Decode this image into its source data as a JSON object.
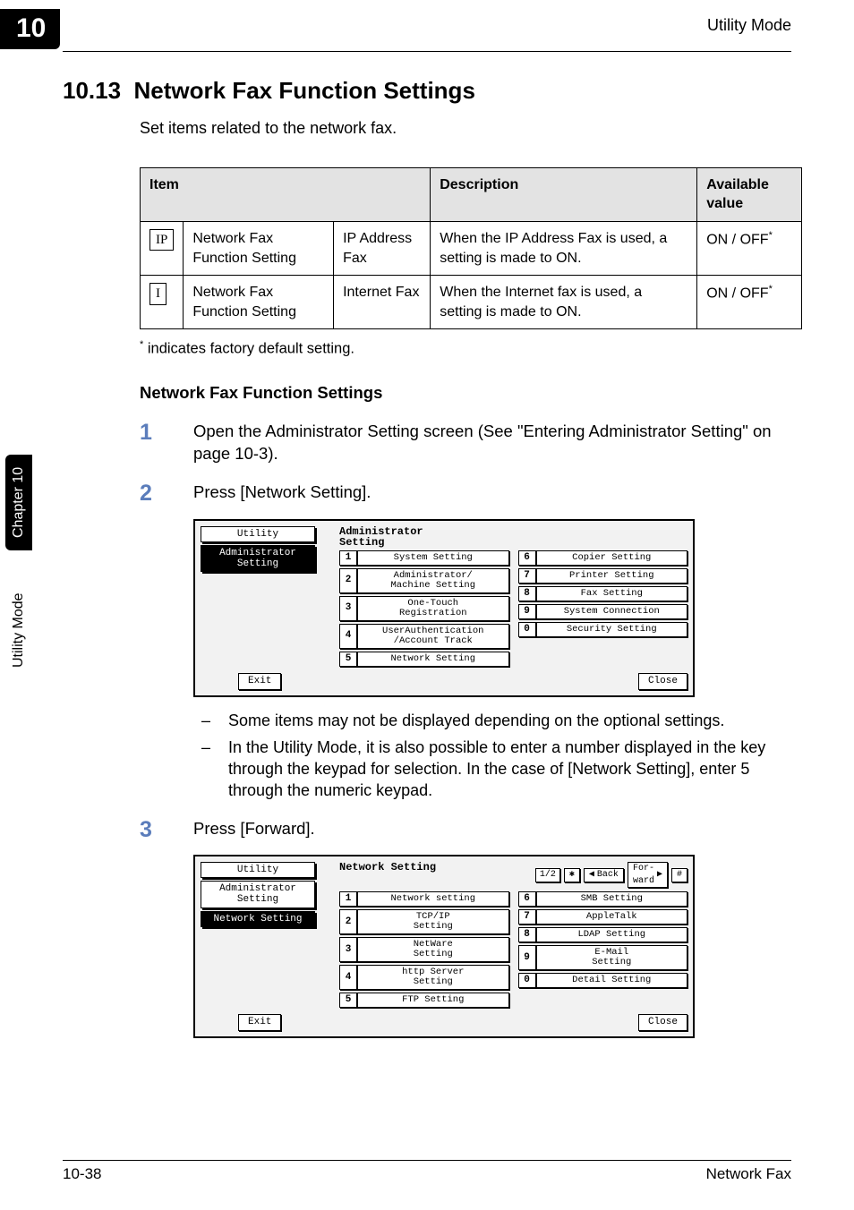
{
  "header": {
    "chapter_num": "10",
    "right": "Utility Mode"
  },
  "section": {
    "number": "10.13",
    "title": "Network Fax Function Settings",
    "intro": "Set items related to the network fax."
  },
  "table": {
    "headers": {
      "item": "Item",
      "desc": "Description",
      "avail": "Available value"
    },
    "rows": [
      {
        "icon": "IP",
        "col1": "Network Fax Function Setting",
        "col2": "IP Address Fax",
        "desc": "When the IP Address Fax is used, a setting is made to ON.",
        "avail": "ON / OFF",
        "avail_sup": "*"
      },
      {
        "icon": "I",
        "col1": "Network Fax Function Setting",
        "col2": "Internet Fax",
        "desc": "When the Internet fax is used, a setting is made to ON.",
        "avail": "ON / OFF",
        "avail_sup": "*"
      }
    ]
  },
  "footnote": {
    "mark": "*",
    "text": " indicates factory default setting."
  },
  "subhead": "Network Fax Function Settings",
  "steps": {
    "s1": {
      "num": "1",
      "text": "Open the Administrator Setting screen (See \"Entering Administrator Setting\" on page 10-3)."
    },
    "s2": {
      "num": "2",
      "text": "Press [Network Setting]."
    },
    "s3": {
      "num": "3",
      "text": "Press [Forward]."
    }
  },
  "bullets": {
    "b1": "Some items may not be displayed depending on the optional settings.",
    "b2": "In the Utility Mode, it is also possible to enter a number displayed in the key through the keypad for selection. In the case of [Network Setting], enter 5 through the numeric keypad."
  },
  "shot1": {
    "side_tab1": "Utility",
    "side_tab2": "Administrator\nSetting",
    "title": "Administrator\nSetting",
    "left": [
      {
        "n": "1",
        "l": "System Setting"
      },
      {
        "n": "2",
        "l": "Administrator/\nMachine Setting"
      },
      {
        "n": "3",
        "l": "One-Touch\nRegistration"
      },
      {
        "n": "4",
        "l": "UserAuthentication\n/Account Track"
      },
      {
        "n": "5",
        "l": "Network Setting"
      }
    ],
    "right": [
      {
        "n": "6",
        "l": "Copier Setting"
      },
      {
        "n": "7",
        "l": "Printer Setting"
      },
      {
        "n": "8",
        "l": "Fax Setting"
      },
      {
        "n": "9",
        "l": "System Connection"
      },
      {
        "n": "0",
        "l": "Security Setting"
      }
    ],
    "exit": "Exit",
    "close": "Close"
  },
  "shot2": {
    "side_tab1": "Utility",
    "side_tab2": "Administrator\nSetting",
    "side_tab3": "Network Setting",
    "title": "Network Setting",
    "page": "1/2",
    "back": "Back",
    "forward": "For-\nward",
    "left": [
      {
        "n": "1",
        "l": "Network setting"
      },
      {
        "n": "2",
        "l": "TCP/IP\nSetting"
      },
      {
        "n": "3",
        "l": "NetWare\nSetting"
      },
      {
        "n": "4",
        "l": "http Server\nSetting"
      },
      {
        "n": "5",
        "l": "FTP Setting"
      }
    ],
    "right": [
      {
        "n": "6",
        "l": "SMB Setting"
      },
      {
        "n": "7",
        "l": "AppleTalk"
      },
      {
        "n": "8",
        "l": "LDAP Setting"
      },
      {
        "n": "9",
        "l": "E-Mail\nSetting"
      },
      {
        "n": "0",
        "l": "Detail Setting"
      }
    ],
    "exit": "Exit",
    "close": "Close"
  },
  "sidetab": {
    "name": "Utility Mode",
    "chapter": "Chapter 10"
  },
  "footer": {
    "left": "10-38",
    "right": "Network Fax"
  }
}
